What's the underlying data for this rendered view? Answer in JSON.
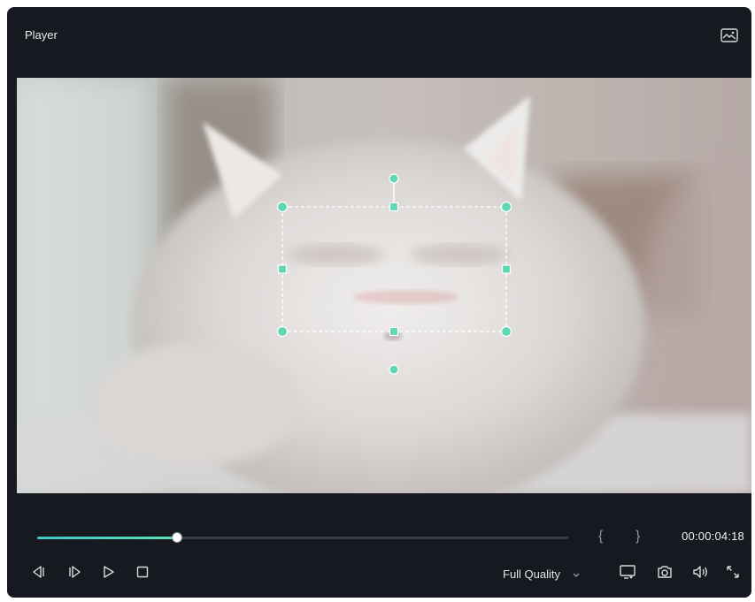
{
  "panel": {
    "title": "Player",
    "header_icon": "image-icon"
  },
  "player": {
    "progress_fraction": 0.263,
    "in_marker": "{",
    "out_marker": "}",
    "timecode": "00:00:04:18",
    "quality": {
      "selected": "Full Quality"
    },
    "buttons": [
      "step-back-icon",
      "step-forward-icon",
      "play-icon",
      "stop-icon",
      "monitor-icon",
      "camera-icon",
      "volume-icon",
      "expand-icon"
    ]
  },
  "colors": {
    "accent": "#5fd6b4",
    "panel_bg": "#161a20",
    "handle_fill": "#5fd6b4"
  }
}
